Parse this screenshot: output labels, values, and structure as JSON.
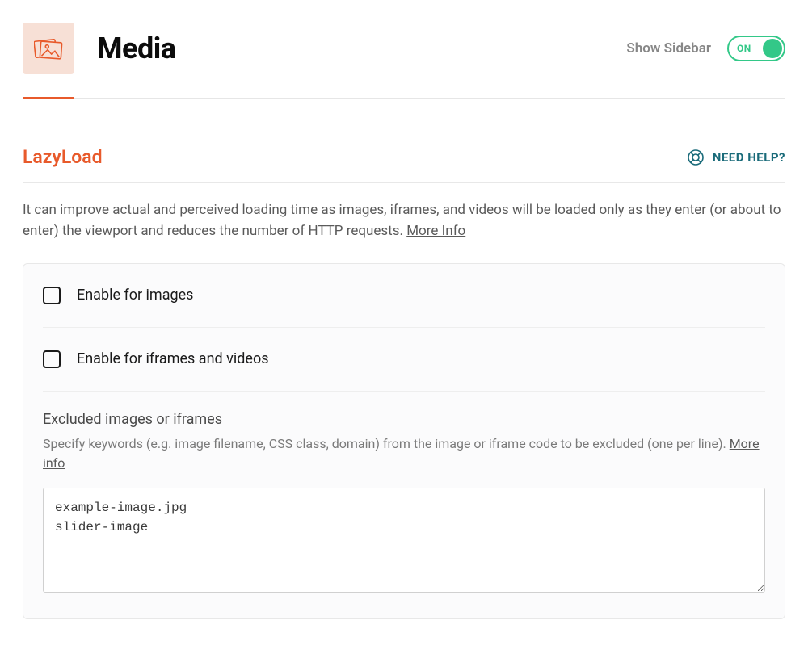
{
  "header": {
    "title": "Media",
    "sidebar_label": "Show Sidebar",
    "toggle_state": "ON"
  },
  "section": {
    "title": "LazyLoad",
    "help_label": "NEED HELP?",
    "description": "It can improve actual and perceived loading time as images, iframes, and videos will be loaded only as they enter (or about to enter) the viewport and reduces the number of HTTP requests. ",
    "more_info": "More Info"
  },
  "options": {
    "enable_images": "Enable for images",
    "enable_iframes": "Enable for iframes and videos"
  },
  "excluded": {
    "title": "Excluded images or iframes",
    "description": "Specify keywords (e.g. image filename, CSS class, domain) from the image or iframe code to be excluded (one per line). ",
    "more_info": "More info",
    "value": "example-image.jpg\nslider-image"
  },
  "colors": {
    "accent": "#e85a2b",
    "toggle": "#33c888",
    "help": "#1a6b7a"
  }
}
